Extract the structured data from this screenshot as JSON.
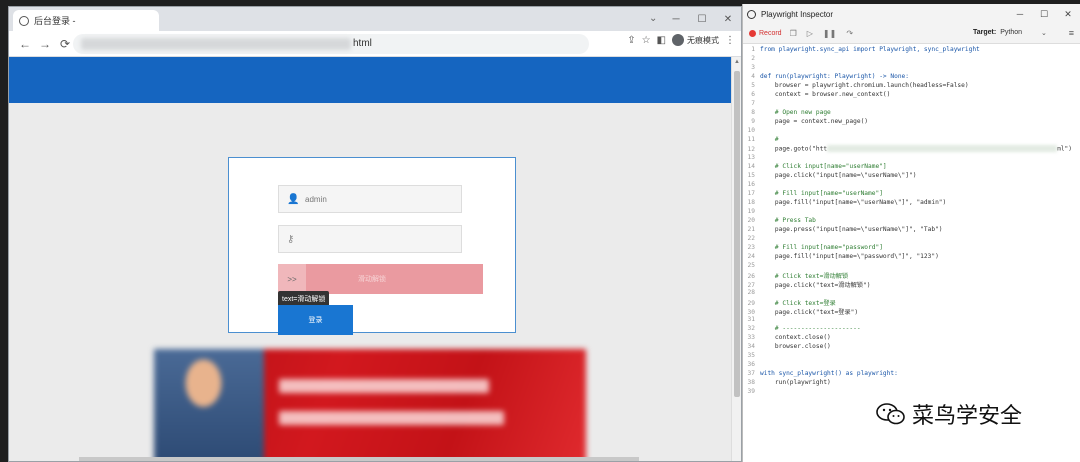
{
  "browser": {
    "tab_title": "后台登录 -",
    "url_suffix": "html",
    "profile_label": "无痕模式",
    "window_controls": [
      "─",
      "☐",
      "✕"
    ],
    "nav": {
      "back": "←",
      "forward": "→",
      "reload": "⟳"
    }
  },
  "page": {
    "username_value": "admin",
    "password_placeholder": "",
    "slider_handle": ">>",
    "slider_text": "滑动解锁",
    "tooltip": "text=滑动解锁",
    "login_button": "登录"
  },
  "inspector": {
    "title": "Playwright Inspector",
    "record_label": "Record",
    "target_label": "Target:",
    "target_value": "Python",
    "window_controls": [
      "─",
      "☐",
      "✕"
    ],
    "code_lines": [
      {
        "n": "1",
        "t": "from playwright.sync_api import Playwright, sync_playwright"
      },
      {
        "n": "2",
        "t": ""
      },
      {
        "n": "3",
        "t": ""
      },
      {
        "n": "4",
        "t": "def run(playwright: Playwright) -> None:"
      },
      {
        "n": "5",
        "t": "    browser = playwright.chromium.launch(headless=False)"
      },
      {
        "n": "6",
        "t": "    context = browser.new_context()"
      },
      {
        "n": "7",
        "t": ""
      },
      {
        "n": "8",
        "t": "    # Open new page"
      },
      {
        "n": "9",
        "t": "    page = context.new_page()"
      },
      {
        "n": "10",
        "t": ""
      },
      {
        "n": "11",
        "t": "    #"
      },
      {
        "n": "12",
        "t": "    page.goto(\"htt"
      },
      {
        "n": "13",
        "t": ""
      },
      {
        "n": "14",
        "t": "    # Click input[name=\"userName\"]"
      },
      {
        "n": "15",
        "t": "    page.click(\"input[name=\\\"userName\\\"]\")"
      },
      {
        "n": "16",
        "t": ""
      },
      {
        "n": "17",
        "t": "    # Fill input[name=\"userName\"]"
      },
      {
        "n": "18",
        "t": "    page.fill(\"input[name=\\\"userName\\\"]\", \"admin\")"
      },
      {
        "n": "19",
        "t": ""
      },
      {
        "n": "20",
        "t": "    # Press Tab"
      },
      {
        "n": "21",
        "t": "    page.press(\"input[name=\\\"userName\\\"]\", \"Tab\")"
      },
      {
        "n": "22",
        "t": ""
      },
      {
        "n": "23",
        "t": "    # Fill input[name=\"password\"]"
      },
      {
        "n": "24",
        "t": "    page.fill(\"input[name=\\\"password\\\"]\", \"123\")"
      },
      {
        "n": "25",
        "t": ""
      },
      {
        "n": "26",
        "t": "    # Click text=滑动解锁"
      },
      {
        "n": "27",
        "t": "    page.click(\"text=滑动解锁\")"
      },
      {
        "n": "28",
        "t": ""
      },
      {
        "n": "29",
        "t": "    # Click text=登录"
      },
      {
        "n": "30",
        "t": "    page.click(\"text=登录\")"
      },
      {
        "n": "31",
        "t": ""
      },
      {
        "n": "32",
        "t": "    # ---------------------"
      },
      {
        "n": "33",
        "t": "    context.close()"
      },
      {
        "n": "34",
        "t": "    browser.close()"
      },
      {
        "n": "35",
        "t": ""
      },
      {
        "n": "36",
        "t": ""
      },
      {
        "n": "37",
        "t": "with sync_playwright() as playwright:"
      },
      {
        "n": "38",
        "t": "    run(playwright)"
      },
      {
        "n": "39",
        "t": ""
      }
    ],
    "line12_suffix": "ml\")"
  },
  "watermark": {
    "text": "菜鸟学安全"
  },
  "colors": {
    "header_blue": "#1565c0",
    "record_red": "#e53935",
    "login_blue": "#1976d2",
    "slider_pink": "#ea9aa0"
  }
}
